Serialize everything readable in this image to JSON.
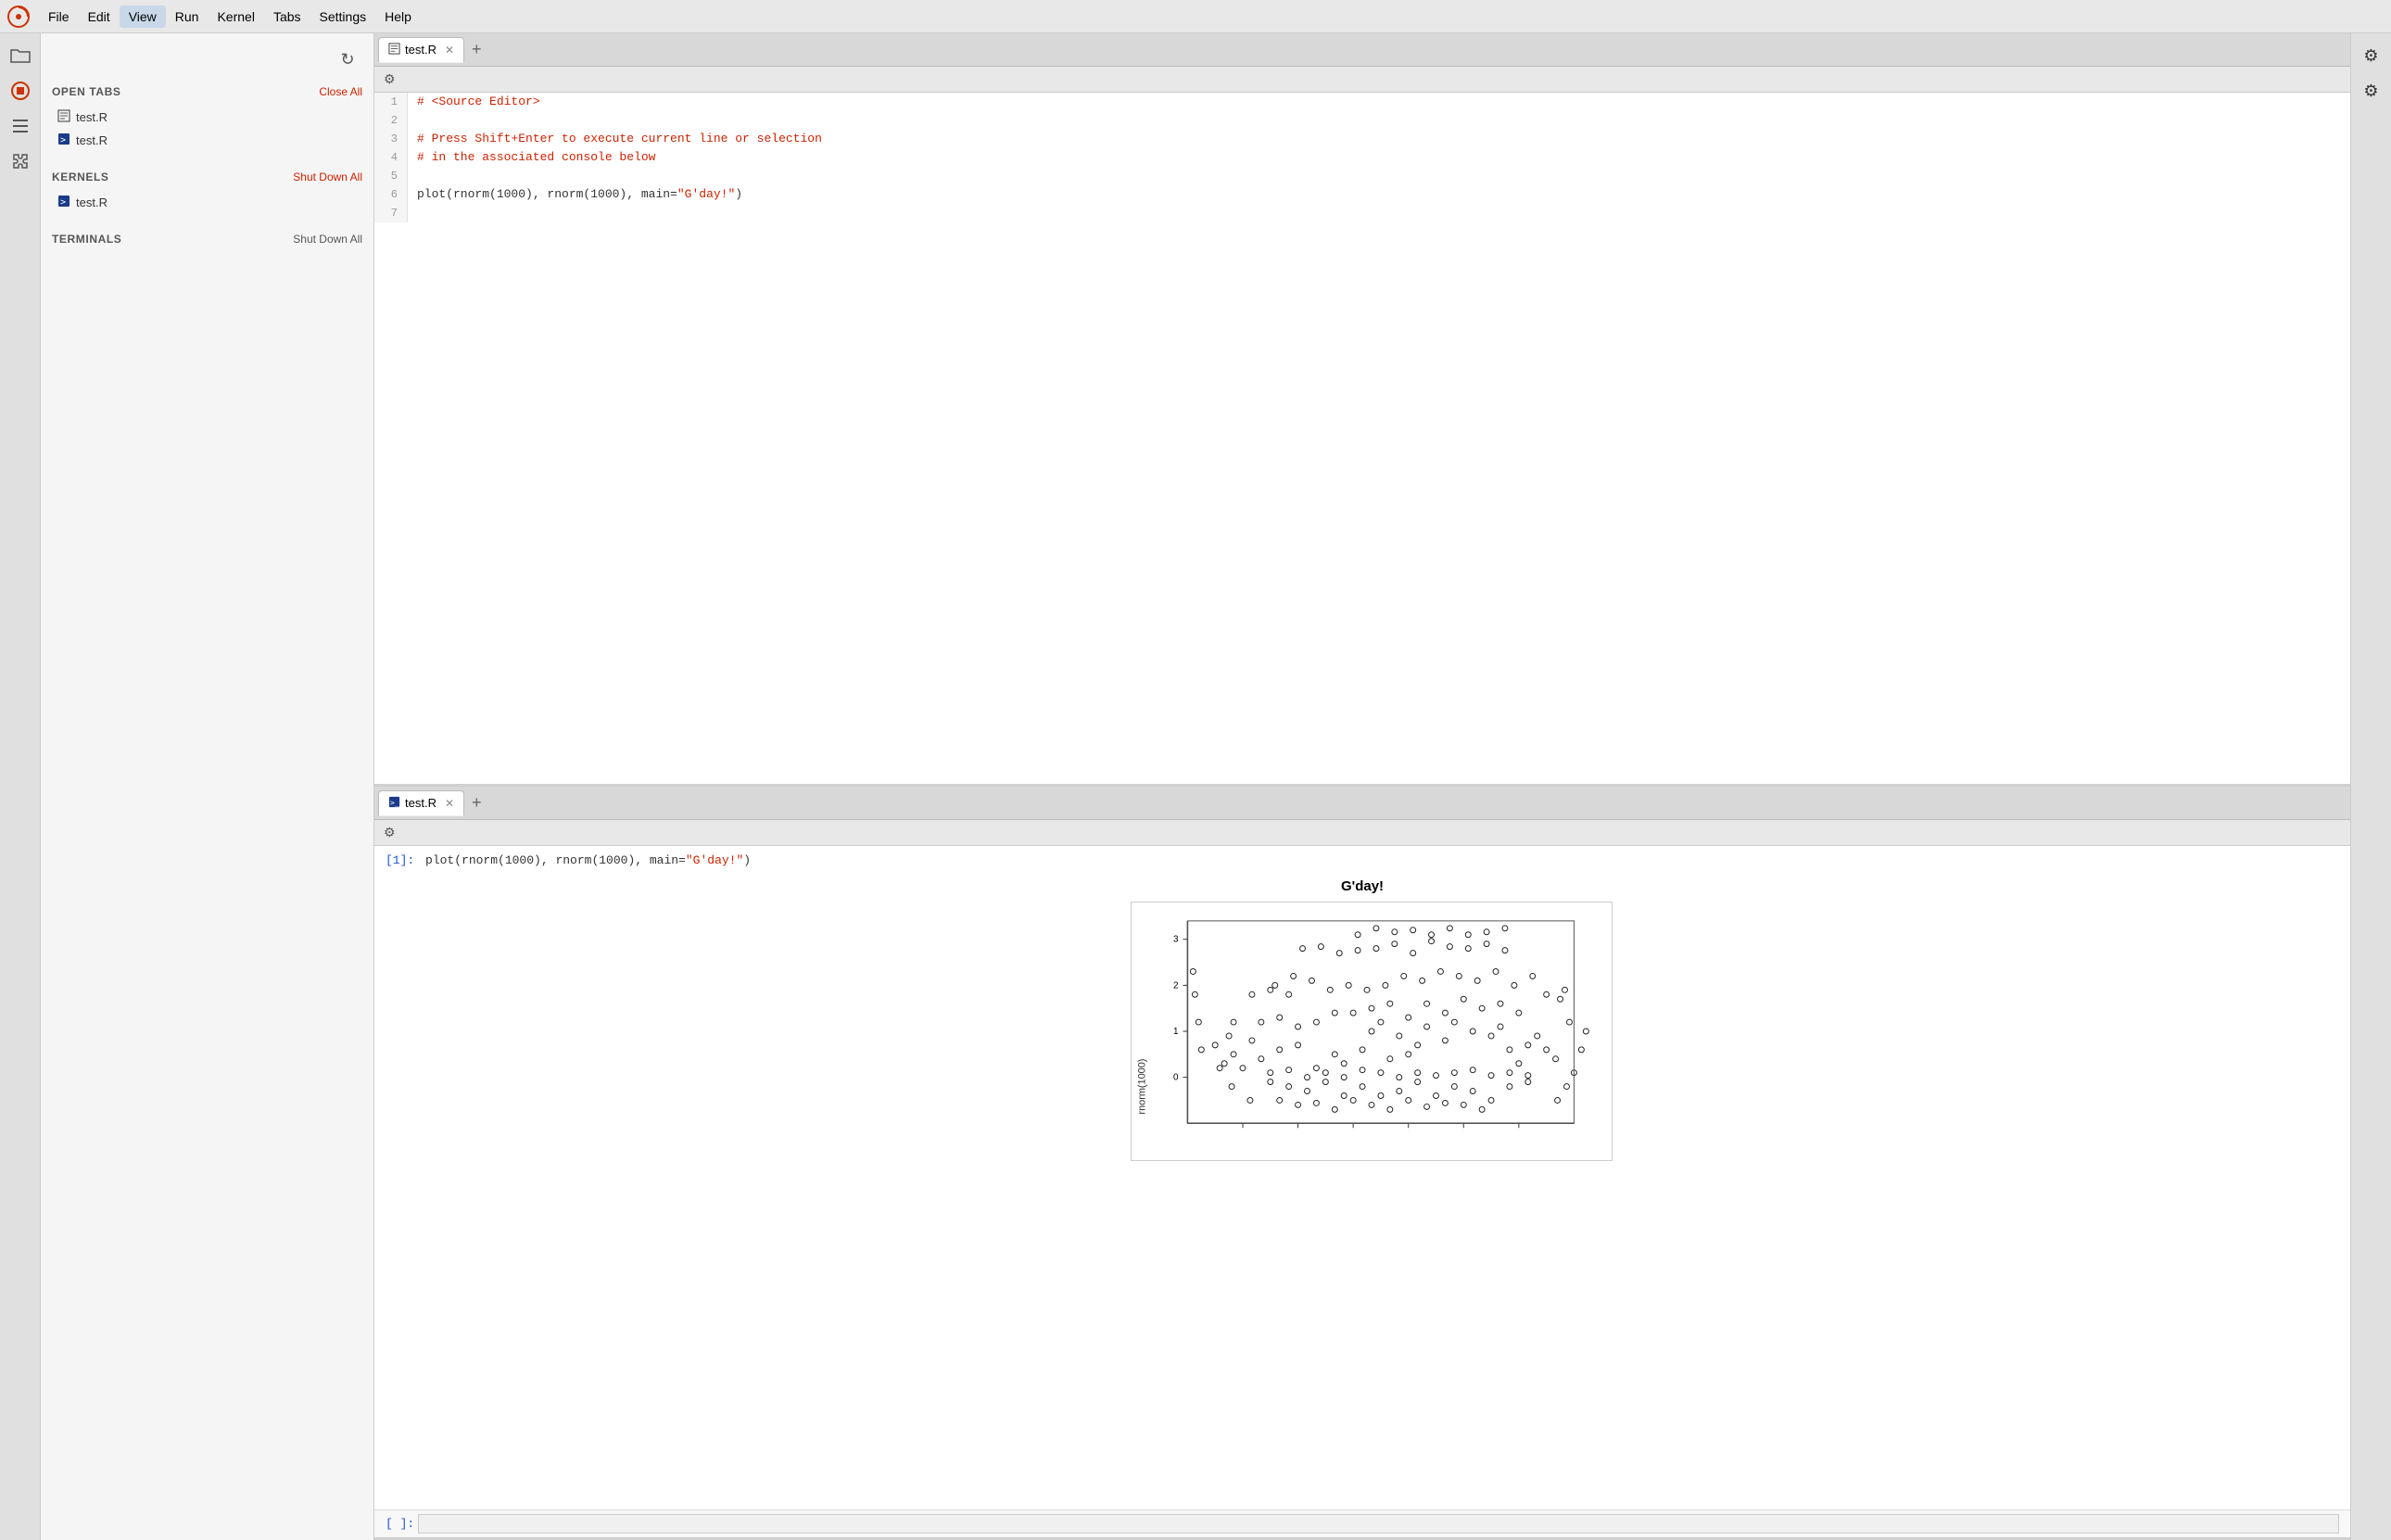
{
  "menubar": {
    "items": [
      "File",
      "Edit",
      "View",
      "Run",
      "Kernel",
      "Tabs",
      "Settings",
      "Help"
    ],
    "active_item": "View"
  },
  "sidebar": {
    "open_tabs_label": "OPEN TABS",
    "close_all_label": "Close All",
    "kernels_label": "KERNELS",
    "kernels_shutdown_label": "Shut Down All",
    "terminals_label": "TERMINALS",
    "terminals_shutdown_label": "Shut Down All",
    "tabs": [
      {
        "name": "test.R",
        "type": "editor"
      },
      {
        "name": "test.R",
        "type": "terminal"
      }
    ],
    "kernels": [
      {
        "name": "test.R",
        "type": "terminal"
      }
    ]
  },
  "editor_panel": {
    "tab_label": "test.R",
    "lines": [
      {
        "num": 1,
        "text": "# <Source Editor>",
        "type": "comment"
      },
      {
        "num": 2,
        "text": "",
        "type": "default"
      },
      {
        "num": 3,
        "text": "# Press Shift+Enter to execute current line or selection",
        "type": "comment"
      },
      {
        "num": 4,
        "text": "# in the associated console below",
        "type": "comment"
      },
      {
        "num": 5,
        "text": "",
        "type": "default"
      },
      {
        "num": 6,
        "text": "plot(rnorm(1000), rnorm(1000), main=\"G'day!\")",
        "type": "code"
      },
      {
        "num": 7,
        "text": "",
        "type": "default"
      }
    ]
  },
  "console_panel": {
    "tab_label": "test.R",
    "prompt_label": "[1]:",
    "command": "plot(rnorm(1000), rnorm(1000), main=",
    "command_string": "\"G'day!\"",
    "command_end": ")",
    "plot_title": "G'day!",
    "input_prompt": "[ ]:",
    "input_placeholder": ""
  },
  "icons": {
    "folder": "📁",
    "stop": "⏹",
    "list": "☰",
    "puzzle": "🧩",
    "gear": "⚙",
    "refresh": "↻",
    "settings_gear": "⚙"
  },
  "colors": {
    "accent_red": "#cc2200",
    "terminal_blue": "#1a3a8a",
    "link_blue": "#1a55cc",
    "comment_red": "#cc2200"
  }
}
